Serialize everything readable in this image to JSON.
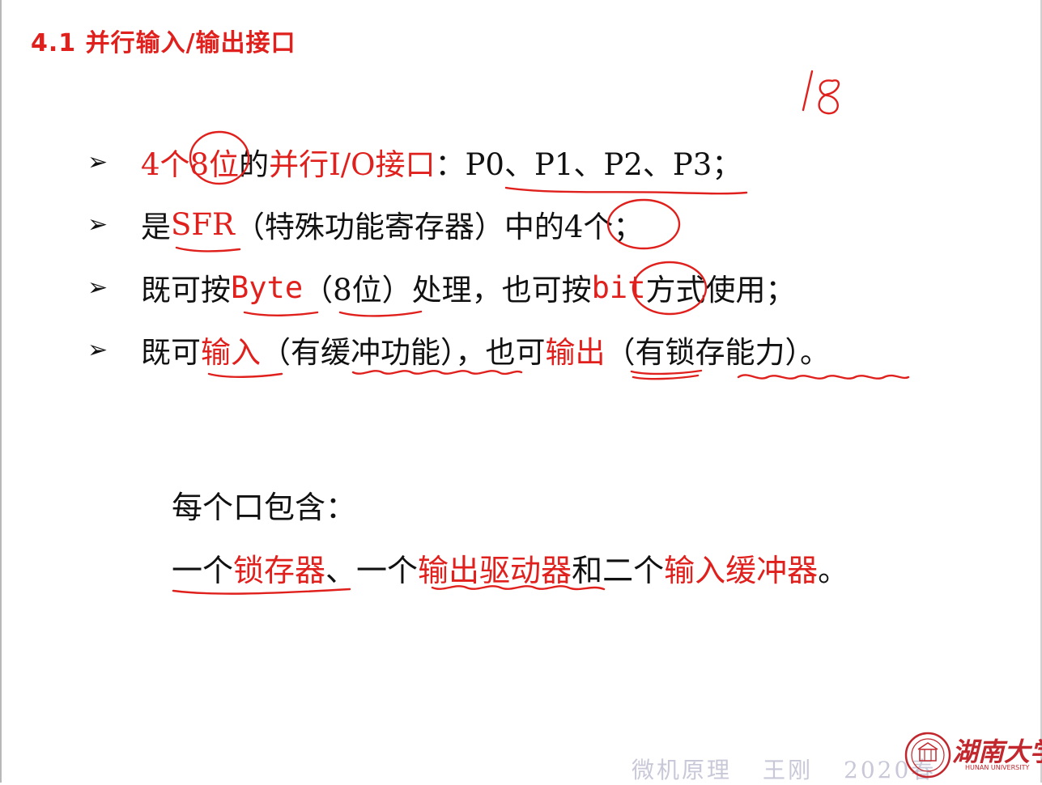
{
  "slide": {
    "title": "4.1 并行输入/输出接口"
  },
  "bullets": [
    {
      "marker": "➢",
      "parts": [
        "4个8位",
        "的",
        "并行I/O接口",
        "：P0、P1、P2、P3；"
      ]
    },
    {
      "marker": "➢",
      "parts": [
        "是",
        "SFR",
        "（特殊功能寄存器）中的4个；"
      ]
    },
    {
      "marker": "➢",
      "parts": [
        "既可按",
        "Byte",
        "（8位）处理，也可按",
        "bit",
        "方式使用；"
      ]
    },
    {
      "marker": "➢",
      "parts": [
        "既可",
        "输入",
        "（有缓冲功能），也可",
        "输出",
        "（有锁存能力）。"
      ]
    }
  ],
  "paragraph": {
    "heading": "每个口包含：",
    "parts": [
      "一个",
      "锁存器",
      "、一个",
      "输出驱动器",
      "和二个",
      "输入缓冲器",
      "。"
    ]
  },
  "footer": {
    "course": "微机原理",
    "teacher": "王刚",
    "term": "2020春"
  },
  "logo": {
    "name": "湖南大学",
    "english": "HUNAN UNIVERSITY"
  },
  "annotations": {
    "ink_color": "#e0201c"
  }
}
